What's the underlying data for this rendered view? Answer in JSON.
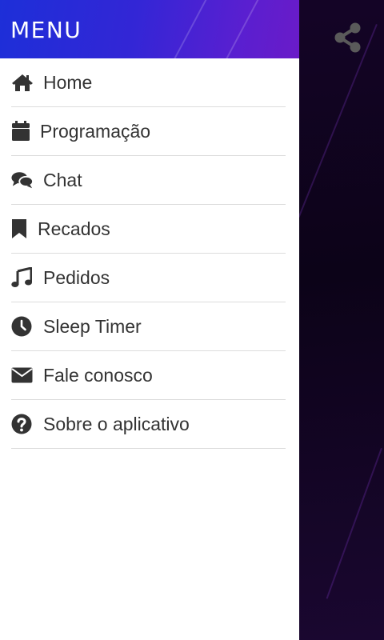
{
  "drawer": {
    "title": "MENU",
    "items": [
      {
        "label": "Home",
        "icon": "home-icon"
      },
      {
        "label": "Programação",
        "icon": "calendar-icon"
      },
      {
        "label": "Chat",
        "icon": "chat-icon"
      },
      {
        "label": "Recados",
        "icon": "bookmark-icon"
      },
      {
        "label": "Pedidos",
        "icon": "music-note-icon"
      },
      {
        "label": "Sleep Timer",
        "icon": "clock-icon"
      },
      {
        "label": "Fale conosco",
        "icon": "envelope-icon"
      },
      {
        "label": "Sobre o aplicativo",
        "icon": "question-circle-icon"
      }
    ]
  },
  "share": {
    "icon": "share-icon"
  },
  "colors": {
    "header_gradient_start": "#1d2fd8",
    "header_gradient_end": "#6a1bc8",
    "icon": "#333333",
    "text": "#333333",
    "divider": "#dcdcdc",
    "share_icon": "#5a5a5a",
    "background": "#0c0318"
  }
}
